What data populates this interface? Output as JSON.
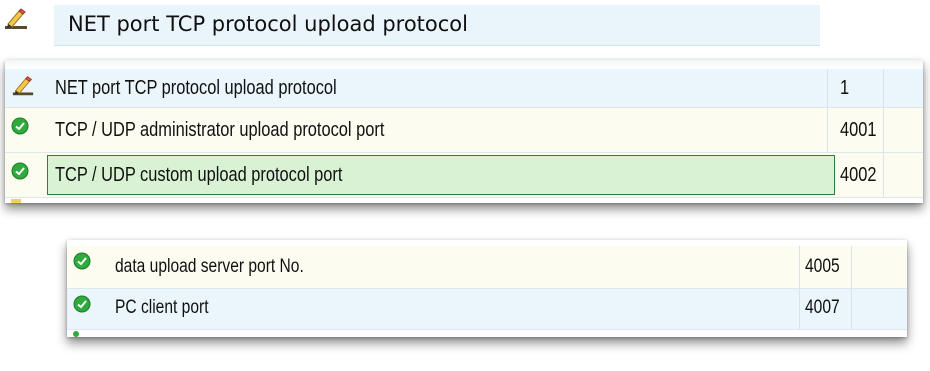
{
  "header": {
    "title": "NET port TCP protocol upload protocol",
    "icon": "edit-icon"
  },
  "panel_top": {
    "rows": [
      {
        "icon": "edit-icon",
        "label": "NET port TCP protocol upload protocol",
        "value": "1",
        "bg": "#eaf6fc"
      },
      {
        "icon": "check-circle-icon",
        "label": "TCP / UDP administrator upload protocol port",
        "value": "4001",
        "bg": "#fdfcf0"
      },
      {
        "icon": "check-circle-icon",
        "label": "TCP / UDP custom upload protocol port",
        "value": "4002",
        "bg": "#d9f2d4",
        "selected": true
      }
    ]
  },
  "panel_bottom": {
    "rows": [
      {
        "icon": "check-circle-icon",
        "label": "data upload server port No.",
        "value": "4005",
        "bg": "#fdfcf0"
      },
      {
        "icon": "check-circle-icon",
        "label": "PC client port",
        "value": "4007",
        "bg": "#eaf6fc"
      }
    ]
  },
  "colors": {
    "check_green": "#2faa3c",
    "selected_border": "#2f7d3a",
    "selected_fill": "#d9f2d4",
    "title_bg": "#eaf5fb"
  }
}
